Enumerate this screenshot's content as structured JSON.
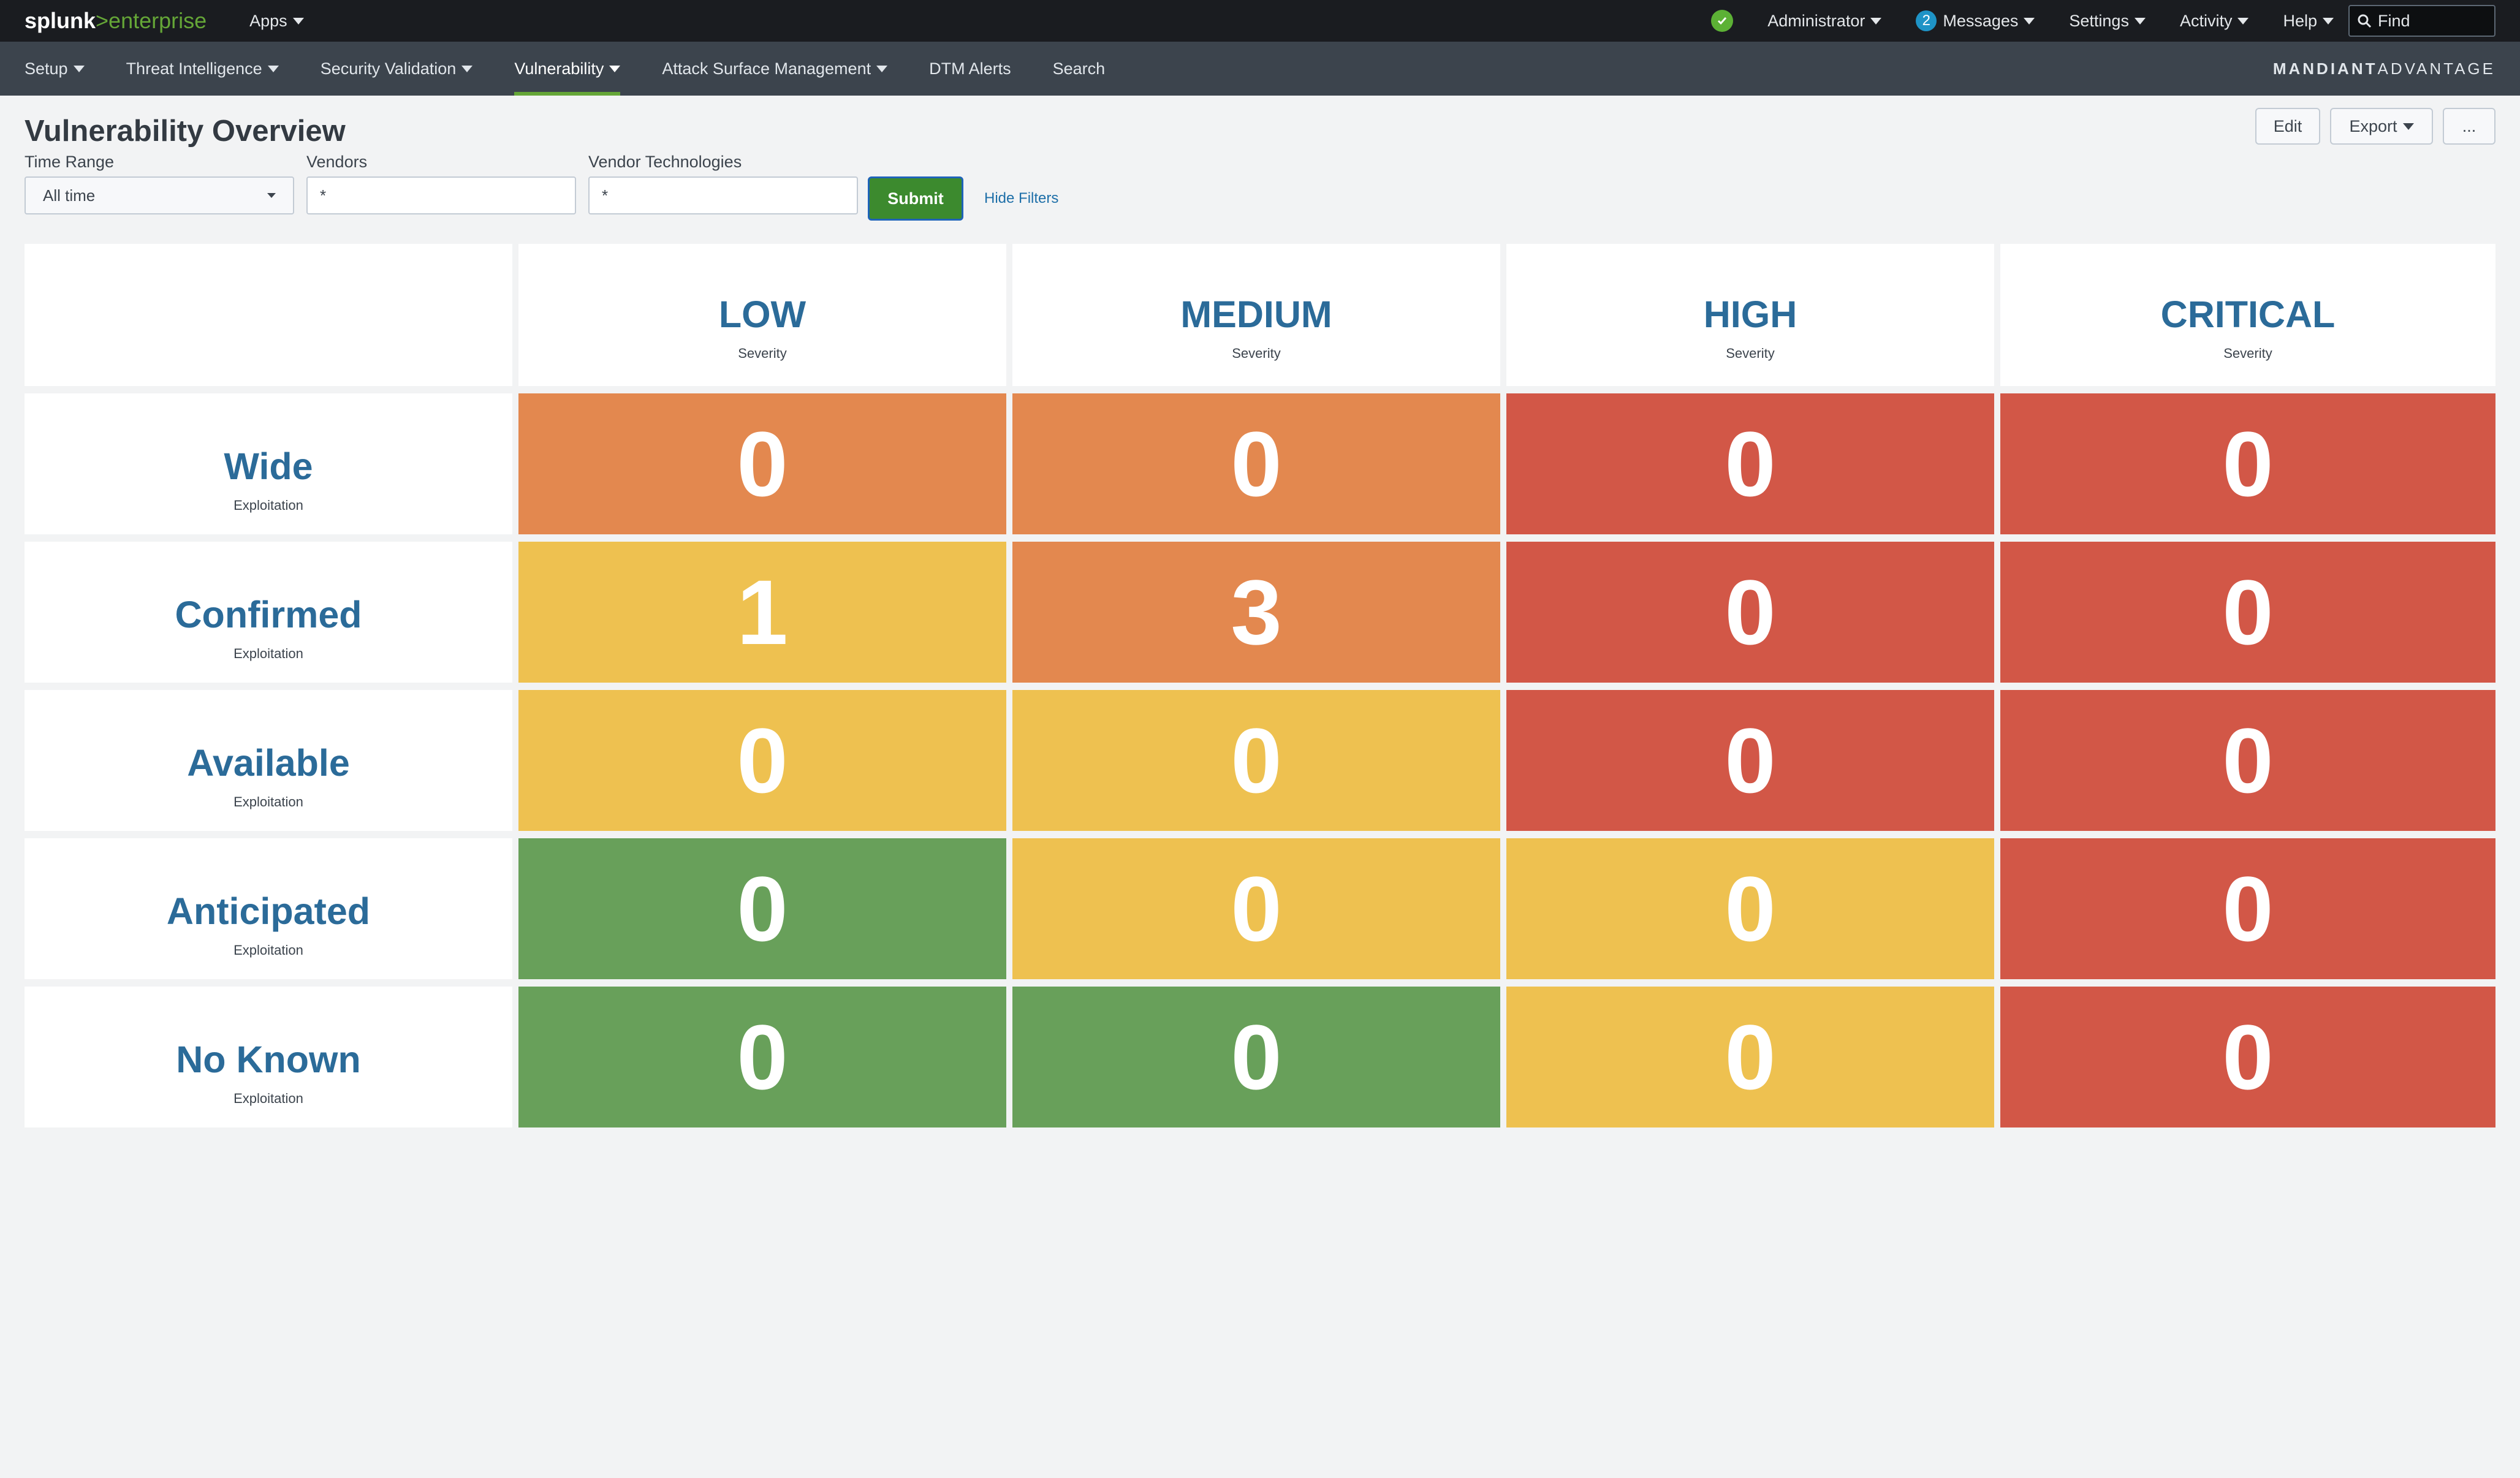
{
  "topbar": {
    "logo_main": "splunk",
    "logo_sep": ">",
    "logo_suffix": "enterprise",
    "apps": "Apps",
    "status_icon": "check-circle-icon",
    "user": "Administrator",
    "messages_count": "2",
    "messages": "Messages",
    "settings": "Settings",
    "activity": "Activity",
    "help": "Help",
    "find_placeholder": "Find"
  },
  "nav": {
    "items": [
      {
        "label": "Setup",
        "dropdown": true
      },
      {
        "label": "Threat Intelligence",
        "dropdown": true
      },
      {
        "label": "Security Validation",
        "dropdown": true
      },
      {
        "label": "Vulnerability",
        "dropdown": true,
        "active": true
      },
      {
        "label": "Attack Surface Management",
        "dropdown": true
      },
      {
        "label": "DTM Alerts",
        "dropdown": false
      },
      {
        "label": "Search",
        "dropdown": false
      }
    ],
    "brand_bold": "MANDIANT",
    "brand_light": "ADVANTAGE"
  },
  "page": {
    "title": "Vulnerability Overview",
    "edit": "Edit",
    "export": "Export",
    "more": "..."
  },
  "filters": {
    "time_range_label": "Time Range",
    "time_range_value": "All time",
    "vendors_label": "Vendors",
    "vendors_value": "*",
    "vendor_tech_label": "Vendor Technologies",
    "vendor_tech_value": "*",
    "submit": "Submit",
    "hide_filters": "Hide Filters"
  },
  "matrix": {
    "columns": [
      {
        "label": "LOW",
        "sub": "Severity"
      },
      {
        "label": "MEDIUM",
        "sub": "Severity"
      },
      {
        "label": "HIGH",
        "sub": "Severity"
      },
      {
        "label": "CRITICAL",
        "sub": "Severity"
      }
    ],
    "rows": [
      {
        "label": "Wide",
        "sub": "Exploitation",
        "values": [
          "0",
          "0",
          "0",
          "0"
        ],
        "colors": [
          "orange",
          "orange",
          "red",
          "red"
        ]
      },
      {
        "label": "Confirmed",
        "sub": "Exploitation",
        "values": [
          "1",
          "3",
          "0",
          "0"
        ],
        "colors": [
          "yellow",
          "orange",
          "red",
          "red"
        ]
      },
      {
        "label": "Available",
        "sub": "Exploitation",
        "values": [
          "0",
          "0",
          "0",
          "0"
        ],
        "colors": [
          "yellow",
          "yellow",
          "red",
          "red"
        ]
      },
      {
        "label": "Anticipated",
        "sub": "Exploitation",
        "values": [
          "0",
          "0",
          "0",
          "0"
        ],
        "colors": [
          "green",
          "yellow",
          "yellow",
          "red"
        ]
      },
      {
        "label": "No Known",
        "sub": "Exploitation",
        "values": [
          "0",
          "0",
          "0",
          "0"
        ],
        "colors": [
          "green",
          "green",
          "yellow",
          "red"
        ]
      }
    ],
    "palette": {
      "orange": "#e3884f",
      "yellow": "#eec150",
      "red": "#d25747",
      "green": "#68a05a"
    }
  }
}
